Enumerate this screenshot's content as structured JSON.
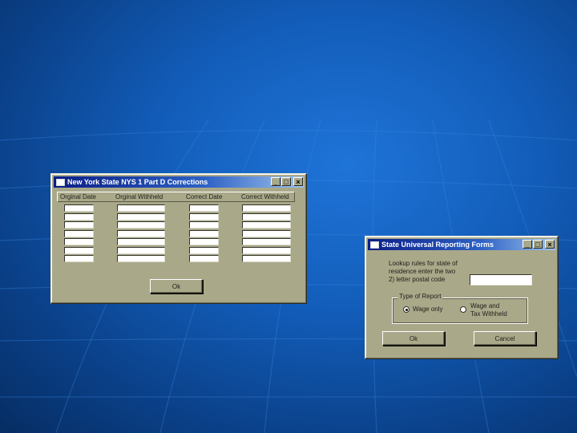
{
  "desktop": {},
  "corrections_window": {
    "title": "New York State NYS 1 Part D Corrections",
    "columns": [
      "Orginal Date",
      "Orginal Withheld",
      "Correct Date",
      "Correct Withheld"
    ],
    "row_count": 7,
    "ok_label": "Ok"
  },
  "universal_window": {
    "title": "State Universal Reporting Forms",
    "prompt_line1": "Lookup rules for state of",
    "prompt_line2": "residence enter the two",
    "prompt_line3": "2) letter postal code",
    "postal_code_value": "",
    "group_label": "Type of Report",
    "options": [
      {
        "label_line1": "Wage only",
        "label_line2": "",
        "selected": true
      },
      {
        "label_line1": "Wage and",
        "label_line2": "Tax Withheld",
        "selected": false
      }
    ],
    "ok_label": "Ok",
    "cancel_label": "Cancel"
  },
  "title_buttons": {
    "minimize": "_",
    "maximize": "□",
    "close": "×"
  }
}
